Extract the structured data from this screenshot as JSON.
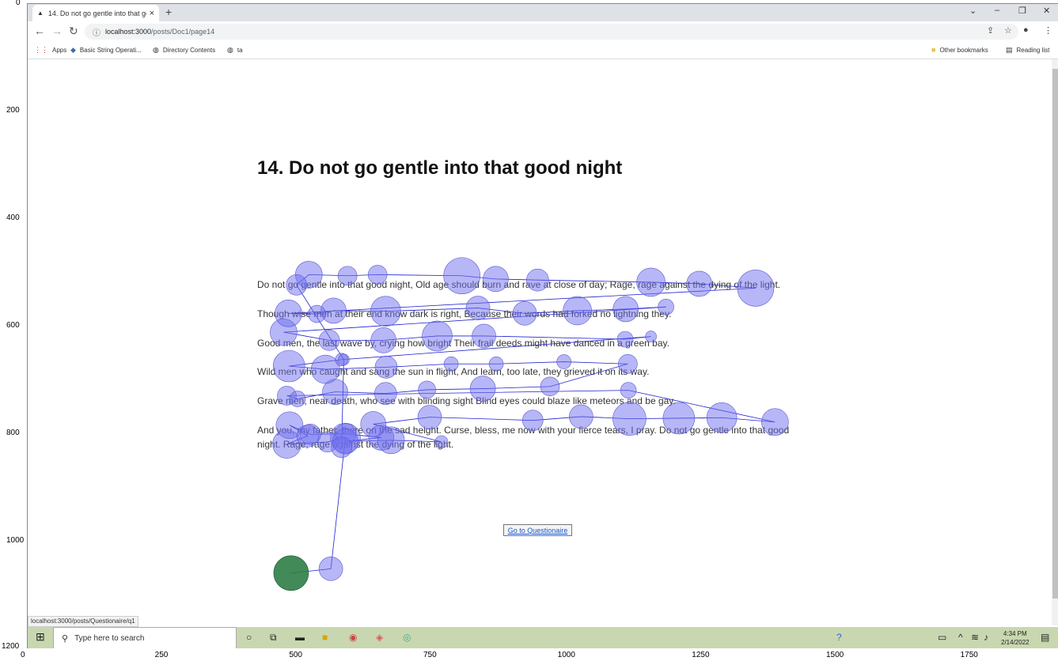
{
  "browser": {
    "tab_title": "14. Do not go gentle into that go",
    "url_host": "localhost:3000",
    "url_path": "/posts/Doc1/page14",
    "bookmarks": [
      "Apps",
      "Basic String Operati...",
      "Directory Contents",
      "ta"
    ],
    "other_bookmarks": "Other bookmarks",
    "reading_list": "Reading list",
    "status_url": "localhost:3000/posts/Questionaire/q1"
  },
  "page": {
    "title": "14. Do not go gentle into that good night",
    "stanzas": [
      "Do not go gentle into that good night, Old age should burn and rave at close of day; Rage, rage against the dying of the light.",
      "Though wise men at their end know dark is right, Because their words had forked no lightning they.",
      "Good men, the last wave by, crying how bright Their frail deeds might have danced in a green bay.",
      "Wild men who caught and sang the sun in flight, And learn, too late, they grieved it on its way.",
      "Grave men, near death, who see with blinding sight Blind eyes could blaze like meteors and be gay.",
      "And you, my father, there on the sad height. Curse, bless, me now with your fierce tears, I pray. Do not go gentle into that good night. Rage, rage against the dying of the light."
    ],
    "button_label": "Go to Questionaire"
  },
  "taskbar": {
    "search_placeholder": "Type here to search",
    "time": "4:34 PM",
    "date": "2/14/2022"
  },
  "axes": {
    "x_ticks": [
      "0",
      "250",
      "500",
      "750",
      "1000",
      "1250",
      "1500",
      "1750"
    ],
    "y_ticks": [
      "0",
      "200",
      "400",
      "600",
      "800",
      "1000",
      "1200"
    ]
  },
  "chart_data": {
    "type": "scatter",
    "xlim": [
      0,
      1920
    ],
    "ylim": [
      1200,
      0
    ],
    "start_color": "#2e7d46",
    "fix_color": "#6f6ff0",
    "line_color": "#1f1fd0",
    "fixations": [
      [
        492,
        1060,
        22
      ],
      [
        566,
        1052,
        15
      ],
      [
        593,
        809,
        19
      ],
      [
        560,
        816,
        13
      ],
      [
        484,
        820,
        18
      ],
      [
        523,
        805,
        14
      ],
      [
        489,
        785,
        17
      ],
      [
        528,
        802,
        13
      ],
      [
        594,
        801,
        13
      ],
      [
        660,
        808,
        16
      ],
      [
        593,
        815,
        16
      ],
      [
        678,
        813,
        17
      ],
      [
        772,
        816,
        8
      ],
      [
        645,
        783,
        16
      ],
      [
        750,
        770,
        15
      ],
      [
        942,
        776,
        13
      ],
      [
        1032,
        769,
        15
      ],
      [
        1122,
        773,
        21
      ],
      [
        1214,
        772,
        20
      ],
      [
        1294,
        771,
        19
      ],
      [
        1393,
        779,
        17
      ],
      [
        1120,
        720,
        10
      ],
      [
        484,
        730,
        12
      ],
      [
        504,
        736,
        10
      ],
      [
        574,
        723,
        16
      ],
      [
        668,
        726,
        14
      ],
      [
        745,
        719,
        11
      ],
      [
        849,
        717,
        16
      ],
      [
        974,
        713,
        12
      ],
      [
        1119,
        671,
        12
      ],
      [
        1000,
        667,
        9
      ],
      [
        874,
        671,
        9
      ],
      [
        790,
        671,
        9
      ],
      [
        669,
        677,
        14
      ],
      [
        556,
        681,
        18
      ],
      [
        488,
        675,
        20
      ],
      [
        586,
        663,
        8
      ],
      [
        1162,
        620,
        7
      ],
      [
        1114,
        625,
        10
      ],
      [
        851,
        619,
        15
      ],
      [
        764,
        619,
        19
      ],
      [
        664,
        627,
        16
      ],
      [
        563,
        627,
        13
      ],
      [
        478,
        612,
        17
      ],
      [
        1190,
        565,
        10
      ],
      [
        1115,
        569,
        16
      ],
      [
        1025,
        572,
        18
      ],
      [
        927,
        577,
        15
      ],
      [
        840,
        567,
        15
      ],
      [
        668,
        573,
        19
      ],
      [
        571,
        572,
        16
      ],
      [
        540,
        578,
        11
      ],
      [
        487,
        577,
        17
      ],
      [
        1357,
        530,
        23
      ],
      [
        1252,
        522,
        16
      ],
      [
        1162,
        519,
        18
      ],
      [
        951,
        515,
        14
      ],
      [
        873,
        513,
        16
      ],
      [
        810,
        507,
        23
      ],
      [
        653,
        505,
        12
      ],
      [
        597,
        507,
        12
      ],
      [
        525,
        505,
        17
      ],
      [
        502,
        524,
        13
      ],
      [
        590,
        663,
        7
      ],
      [
        586,
        826,
        13
      ]
    ]
  }
}
